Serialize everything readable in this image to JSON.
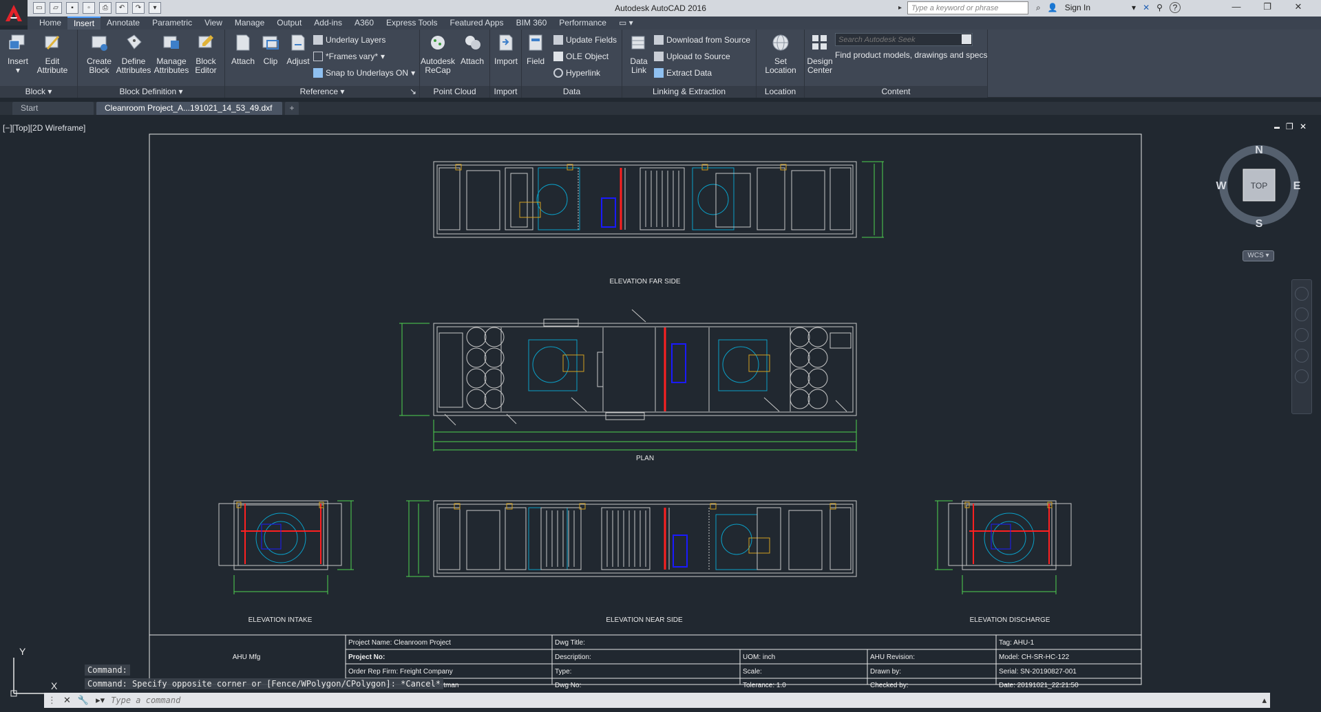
{
  "window": {
    "title": "Autodesk AutoCAD 2016",
    "search_placeholder": "Type a keyword or phrase",
    "sign_in": "Sign In",
    "minimize": "—",
    "restore": "❐",
    "close": "✕"
  },
  "ribbon_tabs": [
    "Home",
    "Insert",
    "Annotate",
    "Parametric",
    "View",
    "Manage",
    "Output",
    "Add-ins",
    "A360",
    "Express Tools",
    "Featured Apps",
    "BIM 360",
    "Performance"
  ],
  "active_tab": "Insert",
  "panels": {
    "block": {
      "title": "Block",
      "insert": "Insert",
      "edit_attribute_1": "Edit",
      "edit_attribute_2": "Attribute"
    },
    "block_definition": {
      "title": "Block Definition",
      "create_block_1": "Create",
      "create_block_2": "Block",
      "define_attributes_1": "Define",
      "define_attributes_2": "Attributes",
      "manage_attributes_1": "Manage",
      "manage_attributes_2": "Attributes",
      "block_editor_1": "Block",
      "block_editor_2": "Editor"
    },
    "reference": {
      "title": "Reference",
      "attach": "Attach",
      "clip": "Clip",
      "adjust": "Adjust",
      "underlay_layers": "Underlay Layers",
      "frames_vary": "*Frames vary*",
      "snap_to_underlays": "Snap to Underlays ON"
    },
    "point_cloud": {
      "title": "Point Cloud",
      "recap_1": "Autodesk",
      "recap_2": "ReCap",
      "attach": "Attach"
    },
    "import": {
      "title": "Import",
      "import": "Import"
    },
    "data": {
      "title": "Data",
      "field": "Field",
      "update_fields": "Update Fields",
      "ole_object": "OLE Object",
      "hyperlink": "Hyperlink"
    },
    "linking": {
      "title": "Linking & Extraction",
      "data_link_1": "Data",
      "data_link_2": "Link",
      "download": "Download from Source",
      "upload": "Upload to Source",
      "extract": "Extract  Data"
    },
    "location": {
      "title": "Location",
      "set_location_1": "Set",
      "set_location_2": "Location"
    },
    "content": {
      "title": "Content",
      "design_center_1": "Design",
      "design_center_2": "Center",
      "seek_placeholder": "Search Autodesk Seek",
      "seek_description": "Find product models, drawings and specs"
    }
  },
  "file_tabs": {
    "start": "Start",
    "active": "Cleanroom Project_A...191021_14_53_49.dxf",
    "new": "+"
  },
  "viewport": {
    "label": "[−][Top][2D Wireframe]",
    "min": "▬",
    "restore": "❐",
    "close": "✕"
  },
  "drawing": {
    "views": {
      "far_side": "ELEVATION FAR SIDE",
      "plan": "PLAN",
      "intake": "ELEVATION INTAKE",
      "near_side": "ELEVATION NEAR SIDE",
      "discharge": "ELEVATION DISCHARGE"
    },
    "title_block": {
      "manufacturer": "AHU Mfg",
      "project_name": "Project Name: Cleanroom Project",
      "project_no": "Project No:",
      "order_rep": "Order Rep Firm: Freight Company",
      "postman": "Postman",
      "dwg_title": "Dwg Title:",
      "description": "Description:",
      "type": "Type:",
      "dwg_no": "Dwg No:",
      "uom": "UOM: inch",
      "scale": "Scale:",
      "tolerance": "Tolerance: 1.0",
      "ahu_revision": "AHU Revision:",
      "drawn_by": "Drawn by:",
      "checked_by": "Checked by:",
      "tag": "Tag: AHU-1",
      "model": "Model: CH-SR-HC-122",
      "serial": "Serial: SN-20190827-001",
      "date": "Date: 20191021_22:21:50"
    }
  },
  "viewcube": {
    "n": "N",
    "s": "S",
    "e": "E",
    "w": "W",
    "top": "TOP",
    "wcs": "WCS"
  },
  "ucs": {
    "y": "Y",
    "x": "X"
  },
  "command": {
    "history_1": "Command:",
    "history_2": "Command: Specify opposite corner or [Fence/WPolygon/CPolygon]: *Cancel*",
    "placeholder": "Type a command"
  },
  "colors": {
    "background": "#212830",
    "ribbon": "#3f4754",
    "accent": "#4a9cff",
    "outline": "#c8c8c8",
    "dimension": "#4fd34f",
    "coil_blue": "#1a1aff",
    "coil_red": "#ff2020",
    "fan": "#0aa0c8",
    "motor": "#d4a020"
  }
}
